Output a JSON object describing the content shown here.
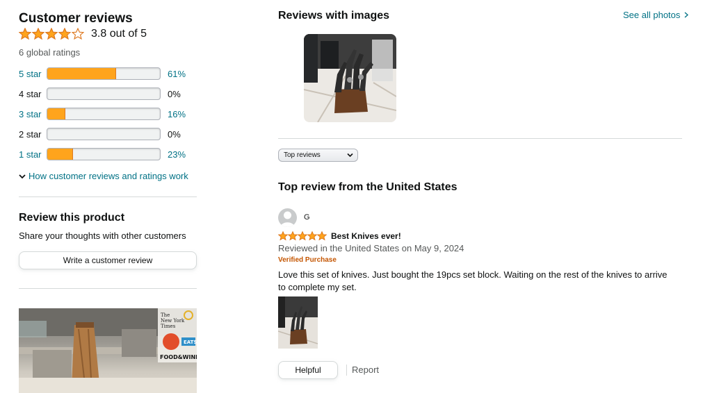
{
  "summary": {
    "title": "Customer reviews",
    "rating": 3.8,
    "rating_text": "3.8 out of 5",
    "global_ratings": "6 global ratings",
    "histogram": [
      {
        "label": "5 star",
        "percent": 61,
        "percent_text": "61%"
      },
      {
        "label": "4 star",
        "percent": 0,
        "percent_text": "0%"
      },
      {
        "label": "3 star",
        "percent": 16,
        "percent_text": "16%"
      },
      {
        "label": "2 star",
        "percent": 0,
        "percent_text": "0%"
      },
      {
        "label": "1 star",
        "percent": 23,
        "percent_text": "23%"
      }
    ],
    "how_link": "How customer reviews and ratings work"
  },
  "review_product": {
    "title": "Review this product",
    "subtitle": "Share your thoughts with other customers",
    "button": "Write a customer review"
  },
  "reviews_with_images": {
    "title": "Reviews with images",
    "see_all": "See all photos"
  },
  "sort": {
    "selected": "Top reviews"
  },
  "top_review": {
    "section_title": "Top review from the United States",
    "reviewer": "G",
    "rating": 5,
    "headline": "Best Knives ever!",
    "date": "Reviewed in the United States on May 9, 2024",
    "badge": "Verified Purchase",
    "body": "Love this set of knives. Just bought the 19pcs set block. Waiting on the rest of the knives to arrive to complete my set.",
    "helpful_label": "Helpful",
    "report_label": "Report"
  },
  "colors": {
    "link": "#007185",
    "star": "#de7921",
    "bar_fill": "#ffa41c",
    "verified": "#c45500"
  },
  "icons": [
    "star-icon",
    "chevron-down-icon",
    "chevron-right-icon",
    "avatar-icon"
  ]
}
